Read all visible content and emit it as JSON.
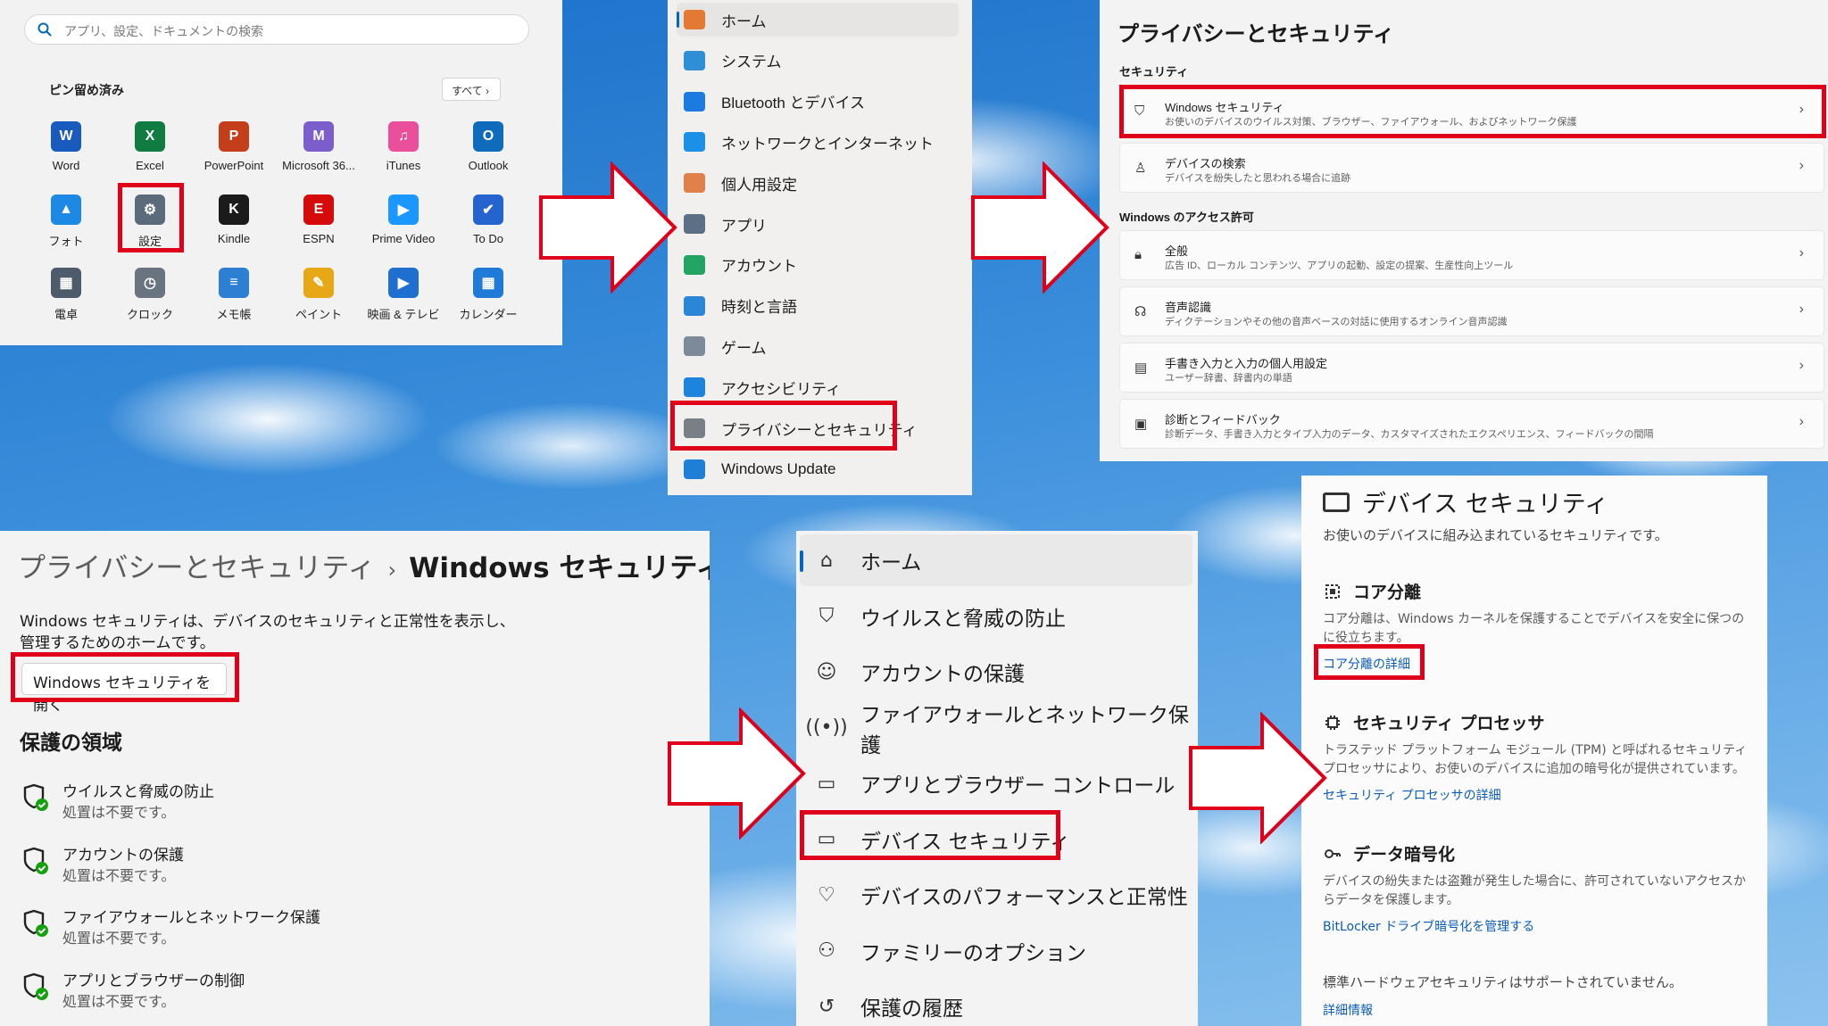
{
  "start_menu": {
    "search_placeholder": "アプリ、設定、ドキュメントの検索",
    "pinned_label": "ピン留め済み",
    "all_label": "すべて ›",
    "apps": [
      {
        "name": "Word",
        "icon": "word-icon",
        "color": "#185abd",
        "glyph": "W"
      },
      {
        "name": "Excel",
        "icon": "excel-icon",
        "color": "#107c41",
        "glyph": "X"
      },
      {
        "name": "PowerPoint",
        "icon": "powerpoint-icon",
        "color": "#c43e1c",
        "glyph": "P"
      },
      {
        "name": "Microsoft 36...",
        "icon": "m365-icon",
        "color": "#7b5ecb",
        "glyph": "M"
      },
      {
        "name": "iTunes",
        "icon": "itunes-icon",
        "color": "#e94f9b",
        "glyph": "♫"
      },
      {
        "name": "Outlook",
        "icon": "outlook-icon",
        "color": "#0f6cbd",
        "glyph": "O"
      },
      {
        "name": "フォト",
        "icon": "photos-icon",
        "color": "#1e88e5",
        "glyph": "▲"
      },
      {
        "name": "設定",
        "icon": "settings-gear-icon",
        "color": "#5b6b7c",
        "glyph": "⚙"
      },
      {
        "name": "Kindle",
        "icon": "kindle-icon",
        "color": "#1b1b1b",
        "glyph": "K"
      },
      {
        "name": "ESPN",
        "icon": "espn-icon",
        "color": "#d50a0a",
        "glyph": "E"
      },
      {
        "name": "Prime Video",
        "icon": "prime-video-icon",
        "color": "#1a98ff",
        "glyph": "▶"
      },
      {
        "name": "To Do",
        "icon": "todo-icon",
        "color": "#2564cf",
        "glyph": "✔"
      },
      {
        "name": "電卓",
        "icon": "calculator-icon",
        "color": "#4d5b6b",
        "glyph": "▦"
      },
      {
        "name": "クロック",
        "icon": "clock-icon",
        "color": "#6a7480",
        "glyph": "◷"
      },
      {
        "name": "メモ帳",
        "icon": "notepad-icon",
        "color": "#2d7fd3",
        "glyph": "≡"
      },
      {
        "name": "ペイント",
        "icon": "paint-icon",
        "color": "#e6a817",
        "glyph": "✎"
      },
      {
        "name": "映画 & テレビ",
        "icon": "movies-tv-icon",
        "color": "#1f6fd1",
        "glyph": "▶"
      },
      {
        "name": "カレンダー",
        "icon": "calendar-icon",
        "color": "#1f7ad8",
        "glyph": "▦"
      }
    ]
  },
  "settings_nav": {
    "items": [
      {
        "label": "ホーム",
        "icon": "home-icon",
        "color": "#e37933"
      },
      {
        "label": "システム",
        "icon": "system-icon",
        "color": "#2f8fd6"
      },
      {
        "label": "Bluetooth とデバイス",
        "icon": "bluetooth-icon",
        "color": "#1b7be0"
      },
      {
        "label": "ネットワークとインターネット",
        "icon": "network-icon",
        "color": "#1c8fe6"
      },
      {
        "label": "個人用設定",
        "icon": "personalization-icon",
        "color": "#e0804a"
      },
      {
        "label": "アプリ",
        "icon": "apps-icon",
        "color": "#5c6f84"
      },
      {
        "label": "アカウント",
        "icon": "accounts-icon",
        "color": "#24a462"
      },
      {
        "label": "時刻と言語",
        "icon": "time-language-icon",
        "color": "#2c86d8"
      },
      {
        "label": "ゲーム",
        "icon": "gaming-icon",
        "color": "#7c8a99"
      },
      {
        "label": "アクセシビリティ",
        "icon": "accessibility-icon",
        "color": "#1d84de"
      },
      {
        "label": "プライバシーとセキュリティ",
        "icon": "privacy-shield-icon",
        "color": "#7a7f86"
      },
      {
        "label": "Windows Update",
        "icon": "windows-update-icon",
        "color": "#1f7fd6"
      }
    ]
  },
  "privacy_page": {
    "title": "プライバシーとセキュリティ",
    "security_label": "セキュリティ",
    "access_label": "Windows のアクセス許可",
    "rows": [
      {
        "title": "Windows セキュリティ",
        "sub": "お使いのデバイスのウイルス対策、ブラウザー、ファイアウォール、およびネットワーク保護",
        "icon": "shield-icon"
      },
      {
        "title": "デバイスの検索",
        "sub": "デバイスを紛失したと思われる場合に追跡",
        "icon": "find-device-icon"
      },
      {
        "title": "全般",
        "sub": "広告 ID、ローカル コンテンツ、アプリの起動、設定の提案、生産性向上ツール",
        "icon": "lock-icon"
      },
      {
        "title": "音声認識",
        "sub": "ディクテーションやその他の音声ベースの対話に使用するオンライン音声認識",
        "icon": "speech-icon"
      },
      {
        "title": "手書き入力と入力の個人用設定",
        "sub": "ユーザー辞書、辞書内の単語",
        "icon": "inking-icon"
      },
      {
        "title": "診断とフィードバック",
        "sub": "診断データ、手書き入力とタイプ入力のデータ、カスタマイズされたエクスペリエンス、フィードバックの間隔",
        "icon": "diagnostics-icon"
      }
    ]
  },
  "windows_security_page": {
    "breadcrumb_parent": "プライバシーとセキュリティ",
    "breadcrumb_sep": "›",
    "breadcrumb_current": "Windows セキュリティ",
    "description": "Windows セキュリティは、デバイスのセキュリティと正常性を表示し、管理するためのホームです。",
    "open_button": "Windows セキュリティを開く",
    "areas_heading": "保護の領域",
    "areas": [
      {
        "title": "ウイルスと脅威の防止",
        "status": "処置は不要です。",
        "icon": "virus-protection-icon"
      },
      {
        "title": "アカウントの保護",
        "status": "処置は不要です。",
        "icon": "account-protection-icon"
      },
      {
        "title": "ファイアウォールとネットワーク保護",
        "status": "処置は不要です。",
        "icon": "firewall-icon"
      },
      {
        "title": "アプリとブラウザーの制御",
        "status": "処置は不要です。",
        "icon": "app-browser-icon"
      }
    ]
  },
  "security_nav": {
    "items": [
      {
        "label": "ホーム",
        "icon": "home-icon"
      },
      {
        "label": "ウイルスと脅威の防止",
        "icon": "shield-icon"
      },
      {
        "label": "アカウントの保護",
        "icon": "person-icon"
      },
      {
        "label": "ファイアウォールとネットワーク保護",
        "icon": "antenna-icon"
      },
      {
        "label": "アプリとブラウザー コントロール",
        "icon": "browser-window-icon"
      },
      {
        "label": "デバイス セキュリティ",
        "icon": "laptop-icon"
      },
      {
        "label": "デバイスのパフォーマンスと正常性",
        "icon": "heart-pulse-icon"
      },
      {
        "label": "ファミリーのオプション",
        "icon": "family-icon"
      },
      {
        "label": "保護の履歴",
        "icon": "history-icon"
      }
    ]
  },
  "device_security": {
    "title": "デバイス セキュリティ",
    "subtitle": "お使いのデバイスに組み込まれているセキュリティです。",
    "core_isolation": {
      "title": "コア分離",
      "desc": "コア分離は、Windows カーネルを保護することでデバイスを安全に保つのに役立ちます。",
      "link": "コア分離の詳細"
    },
    "security_processor": {
      "title": "セキュリティ プロセッサ",
      "desc": "トラステッド プラットフォーム モジュール (TPM) と呼ばれるセキュリティ プロセッサにより、お使いのデバイスに追加の暗号化が提供されています。",
      "link": "セキュリティ プロセッサの詳細"
    },
    "data_encryption": {
      "title": "データ暗号化",
      "desc": "デバイスの紛失または盗難が発生した場合に、許可されていないアクセスからデータを保護します。",
      "link": "BitLocker ドライブ暗号化を管理する"
    },
    "hardware_note": "標準ハードウェアセキュリティはサポートされていません。",
    "details_link": "詳細情報"
  },
  "colors": {
    "highlight": "#e0001a",
    "accent": "#0067c0",
    "link": "#0b5cb8"
  }
}
